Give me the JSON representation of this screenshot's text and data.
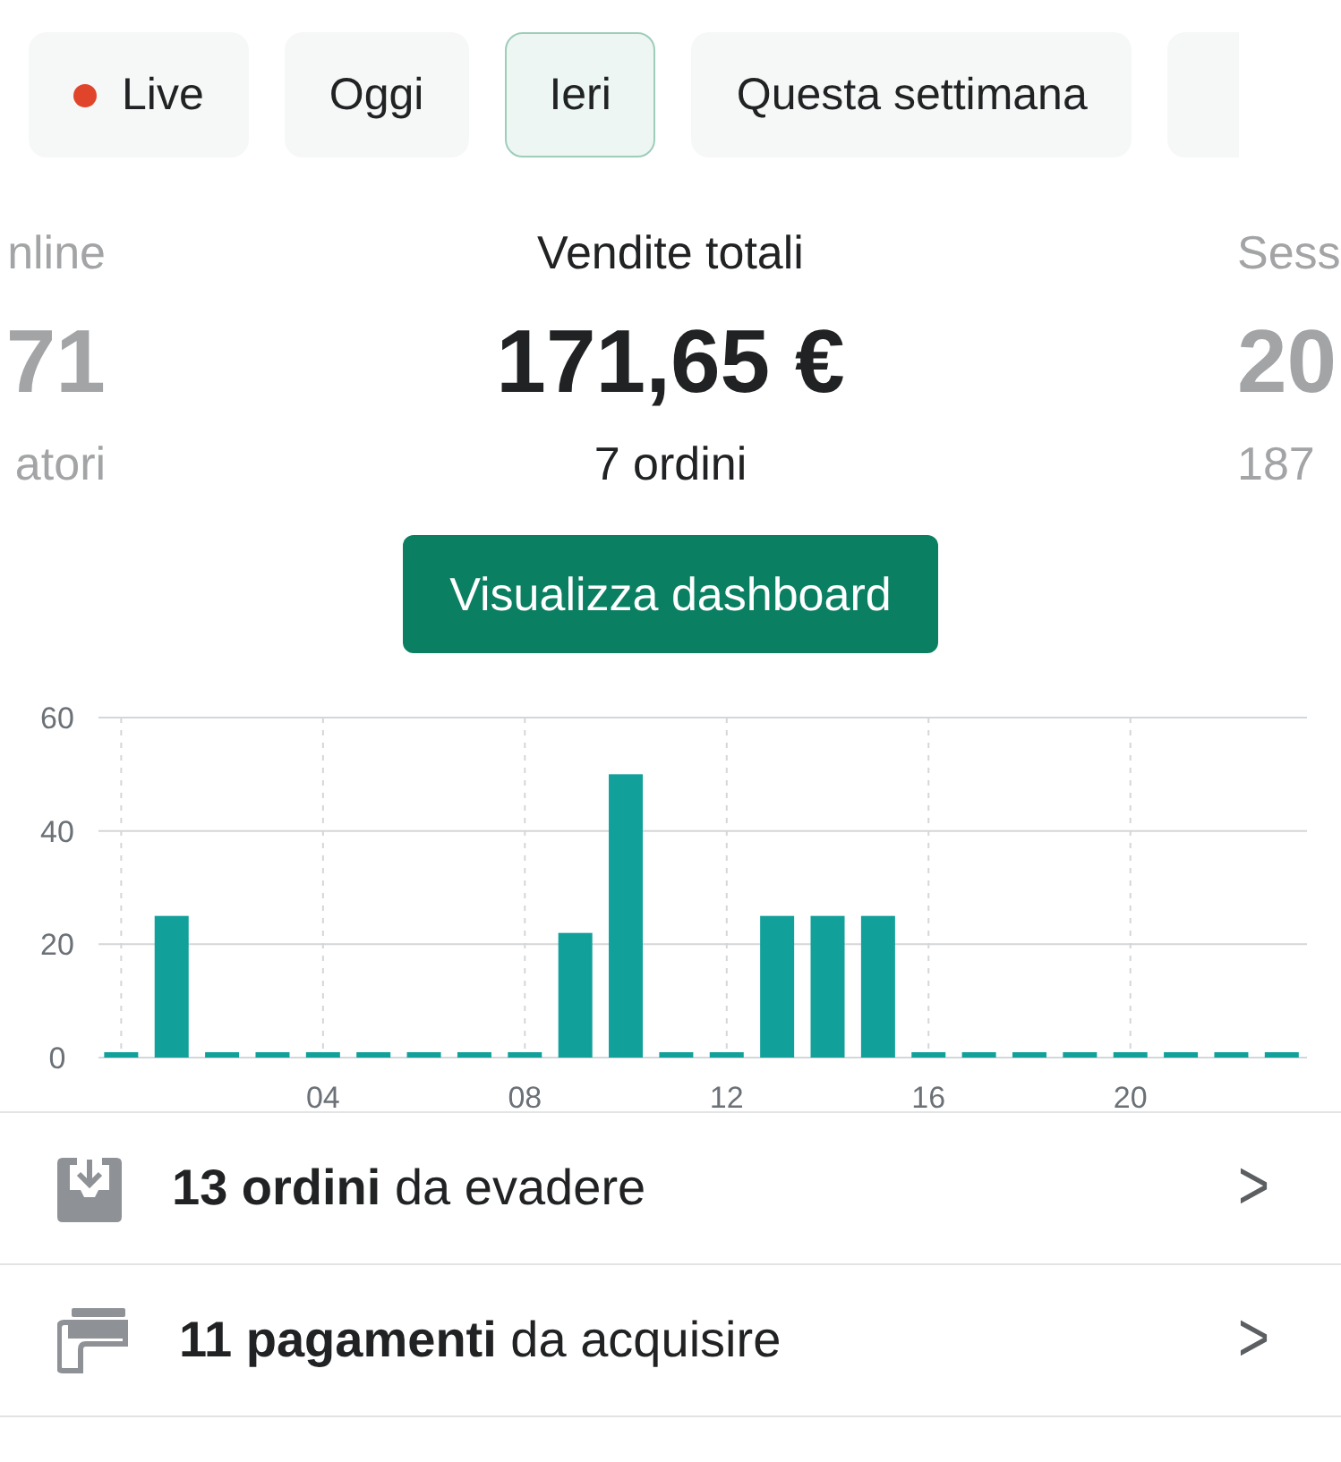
{
  "tabs": [
    {
      "label": "Live",
      "selected": false,
      "live_dot": true
    },
    {
      "label": "Oggi",
      "selected": false,
      "live_dot": false
    },
    {
      "label": "Ieri",
      "selected": true,
      "live_dot": false
    },
    {
      "label": "Questa settimana",
      "selected": false,
      "live_dot": false
    }
  ],
  "stats": {
    "left": {
      "label": "nline",
      "value": "71",
      "sub": "atori"
    },
    "center": {
      "label": "Vendite totali",
      "value": "171,65 €",
      "sub": "7 ordini"
    },
    "right": {
      "label": "Sess",
      "value": "20",
      "sub": "187"
    }
  },
  "dashboard_button": "Visualizza dashboard",
  "chart_data": {
    "type": "bar",
    "grid": true,
    "x": [
      0,
      1,
      2,
      3,
      4,
      5,
      6,
      7,
      8,
      9,
      10,
      11,
      12,
      13,
      14,
      15,
      16,
      17,
      18,
      19,
      20,
      21,
      22,
      23
    ],
    "values": [
      0,
      25,
      0,
      0,
      0,
      0,
      0,
      0,
      0,
      22,
      50,
      0,
      0,
      25,
      25,
      25,
      0,
      0,
      0,
      0,
      0,
      0,
      0,
      0
    ],
    "xlim": [
      -0.45,
      23.5
    ],
    "ylim": [
      0,
      60
    ],
    "yticks": [
      0,
      20,
      40,
      60
    ],
    "xticks": [
      {
        "value": 4,
        "label": "04"
      },
      {
        "value": 8,
        "label": "08"
      },
      {
        "value": 12,
        "label": "12"
      },
      {
        "value": 16,
        "label": "16"
      },
      {
        "value": 20,
        "label": "20"
      }
    ]
  },
  "tasks": [
    {
      "kind": "orders",
      "text": "**13 ordini** da evadere",
      "chevron": ">"
    },
    {
      "kind": "payments",
      "text": "**11 pagamenti** da acquisire",
      "chevron": ">"
    }
  ]
}
